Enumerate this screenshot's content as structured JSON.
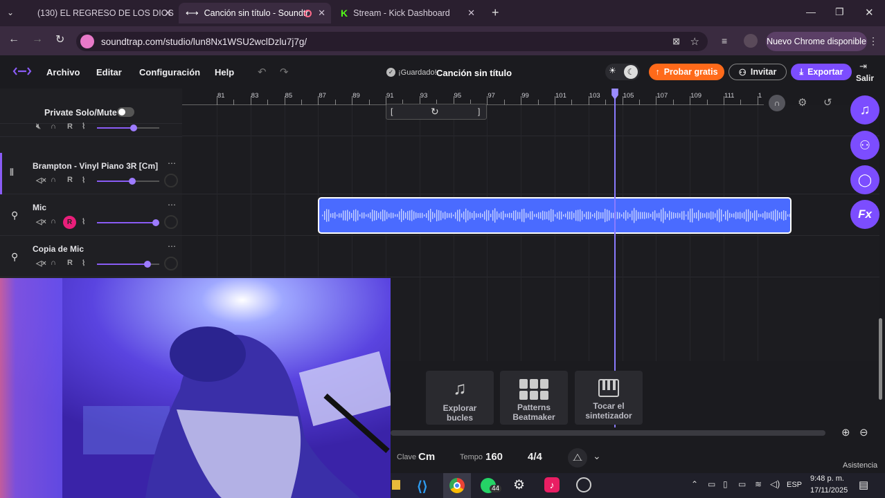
{
  "browser": {
    "tabs": [
      {
        "label": "(130) EL REGRESO DE LOS DIOS",
        "icon": "youtube-icon"
      },
      {
        "label": "Canción sin título - Soundtr",
        "icon": "soundtrap-icon"
      },
      {
        "label": "Stream - Kick Dashboard",
        "icon": "kick-icon"
      }
    ],
    "url": "soundtrap.com/studio/lun8Nx1WSU2wclDzlu7j7g/",
    "update_label": "Nuevo Chrome disponible"
  },
  "app": {
    "menu": [
      "Archivo",
      "Editar",
      "Configuración",
      "Help"
    ],
    "saved_label": "¡Guardado!",
    "song_title": "Canción sin título",
    "try_label": "Probar gratis",
    "invite_label": "Invitar",
    "export_label": "Exportar",
    "exit_label": "Salir",
    "private_solo_label": "Private Solo/Mute",
    "accent": "#7c4dff"
  },
  "ruler": {
    "ticks": [
      "81",
      "83",
      "85",
      "87",
      "89",
      "91",
      "93",
      "95",
      "97",
      "99",
      "101",
      "103",
      "105",
      "107",
      "109",
      "111",
      "1"
    ]
  },
  "tracks": [
    {
      "name": "",
      "record_label": "R",
      "volume": 0.6
    },
    {
      "name": "Brampton - Vinyl Piano 3R [Cm]",
      "record_label": "R",
      "volume": 0.57
    },
    {
      "name": "Mic",
      "record_label": "R",
      "volume": 0.94
    },
    {
      "name": "Copia de Mic",
      "record_label": "R",
      "volume": 0.81
    }
  ],
  "bottom": {
    "cards": [
      {
        "label1": "Explorar",
        "label2": "bucles"
      },
      {
        "label1": "Patterns",
        "label2": "Beatmaker"
      },
      {
        "label1": "Tocar el",
        "label2": "sintetizador"
      }
    ],
    "key_label": "Clave",
    "key_value": "Cm",
    "tempo_label": "Tempo",
    "tempo_value": "160",
    "time_sig": "4/4",
    "assist_label": "Asistencia"
  },
  "taskbar": {
    "whatsapp_badge": "44",
    "lang": "ESP",
    "time": "9:48 p. m.",
    "date": "17/11/2025"
  }
}
